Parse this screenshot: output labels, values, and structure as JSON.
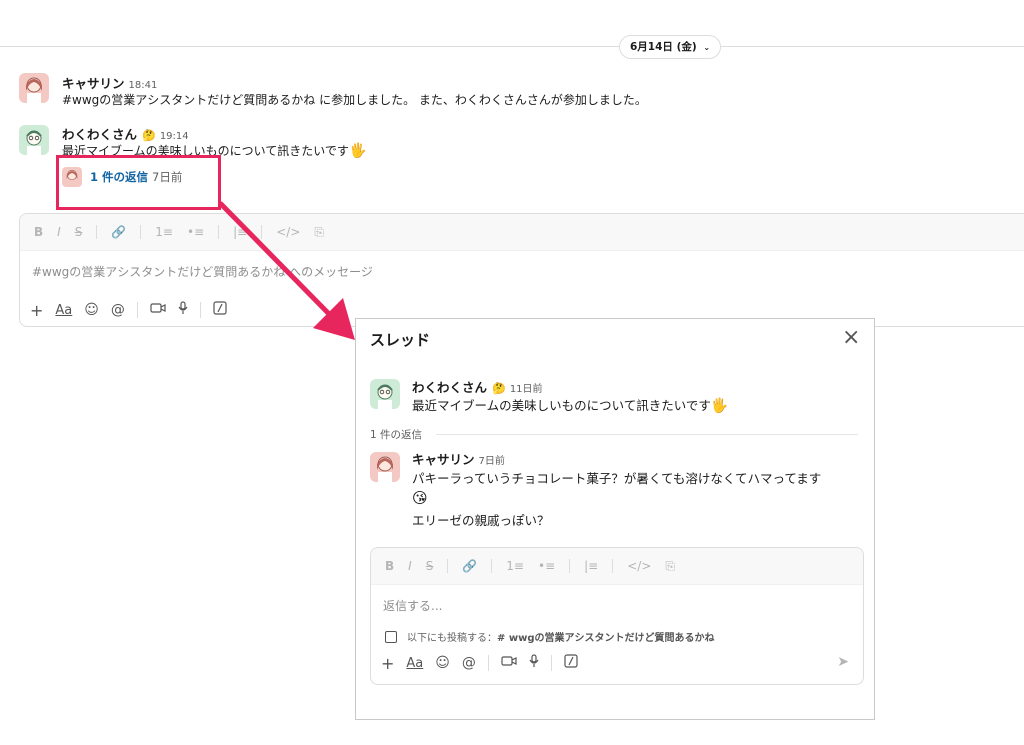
{
  "date_divider": {
    "label": "6月14日 (金)",
    "chevron": "chevron-down-icon"
  },
  "messages": [
    {
      "author": "キャサリン",
      "time": "18:41",
      "text": "#wwgの営業アシスタントだけど質問あるかね に参加しました。 また、わくわくさんさんが参加しました。"
    },
    {
      "author": "わくわくさん",
      "status_emoji": "🤔",
      "time": "19:14",
      "text": "最近マイブームの美味しいものについて訊きたいです",
      "emoji": "🖐",
      "reply_count_label": "1 件の返信",
      "reply_age": "7日前"
    }
  ],
  "composer": {
    "format_icons": [
      "B",
      "I",
      "S",
      "🔗",
      "1≡",
      "•≡",
      "|≡",
      "</>",
      "⎘"
    ],
    "placeholder": "#wwgの営業アシスタントだけど質問あるかね へのメッセージ",
    "tools": [
      "+",
      "Aa",
      "☺",
      "@",
      "video-icon",
      "mic-icon",
      "slash-icon"
    ]
  },
  "thread": {
    "title": "スレッド",
    "close_icon": "close-icon",
    "parent": {
      "author": "わくわくさん",
      "status_emoji": "🤔",
      "time": "11日前",
      "text": "最近マイブームの美味しいものについて訊きたいです",
      "emoji": "🖐"
    },
    "reply_divider": "1 件の返信",
    "reply": {
      "author": "キャサリン",
      "time": "7日前",
      "line1": "パキーラっていうチョコレート菓子？が暑くても溶けなくてハマってます",
      "emoji": "😘",
      "line2": "エリーゼの親戚っぽい？"
    },
    "composer": {
      "placeholder": "返信する...",
      "also_post_prefix": "以下にも投稿する：",
      "also_post_channel": "# wwgの営業アシスタントだけど質問あるかね"
    }
  },
  "colors": {
    "highlight": "#e8265e",
    "link": "#1264a3"
  }
}
